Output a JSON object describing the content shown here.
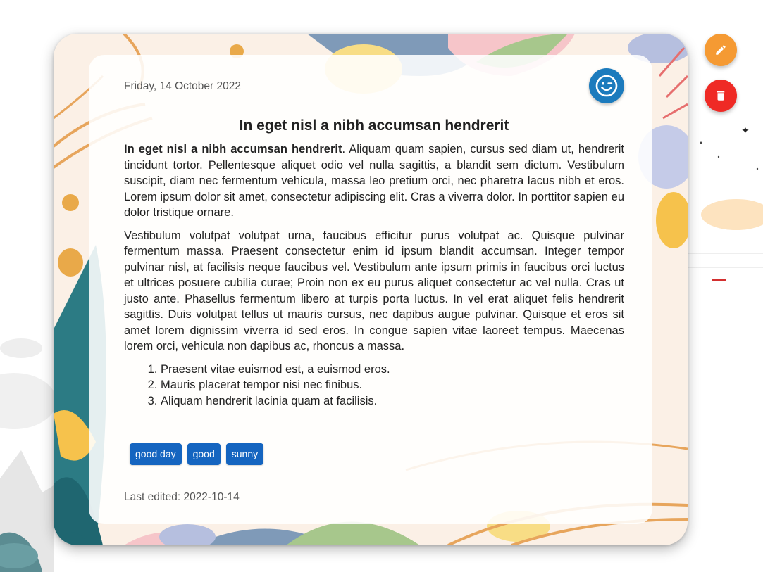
{
  "entry": {
    "date": "Friday, 14 October 2022",
    "title": "In eget nisl a nibh accumsan hendrerit",
    "mood_icon": "winking-face-icon",
    "paragraph1_bold": "In eget nisl a nibh accumsan hendrerit",
    "paragraph1_rest": ". Aliquam quam sapien, cursus sed diam ut, hendrerit tincidunt tortor. Pellentesque aliquet odio vel nulla sagittis, a blandit sem dictum. Vestibulum suscipit, diam nec fermentum vehicula, massa leo pretium orci, nec pharetra lacus nibh et eros. Lorem ipsum dolor sit amet, consectetur adipiscing elit. Cras a viverra dolor. In porttitor sapien eu dolor tristique ornare.",
    "paragraph2": "Vestibulum volutpat volutpat urna, faucibus efficitur purus volutpat ac. Quisque pulvinar fermentum massa. Praesent consectetur enim id ipsum blandit accumsan. Integer tempor pulvinar nisl, at facilisis neque faucibus vel. Vestibulum ante ipsum primis in faucibus orci luctus et ultrices posuere cubilia curae; Proin non ex eu purus aliquet consectetur ac vel nulla. Cras ut justo ante. Phasellus fermentum libero at turpis porta luctus. In vel erat aliquet felis hendrerit sagittis. Duis volutpat tellus ut mauris cursus, nec dapibus augue pulvinar. Quisque et eros sit amet lorem dignissim viverra id sed eros. In congue sapien vitae laoreet tempus. Maecenas lorem orci, vehicula non dapibus ac, rhoncus a massa.",
    "list_items": [
      "Praesent vitae euismod est, a euismod eros.",
      "Mauris placerat tempor nisi nec finibus.",
      "Aliquam hendrerit lacinia quam at facilisis."
    ],
    "tags": [
      "good day",
      "good",
      "sunny"
    ],
    "last_edited": "Last edited: 2022-10-14"
  },
  "actions": {
    "edit_icon": "pencil-icon",
    "delete_icon": "trash-icon"
  },
  "colors": {
    "mood_badge": "#1c7bbd",
    "tag": "#1565c0",
    "edit_button": "#f59a33",
    "delete_button": "#ef2a25"
  }
}
